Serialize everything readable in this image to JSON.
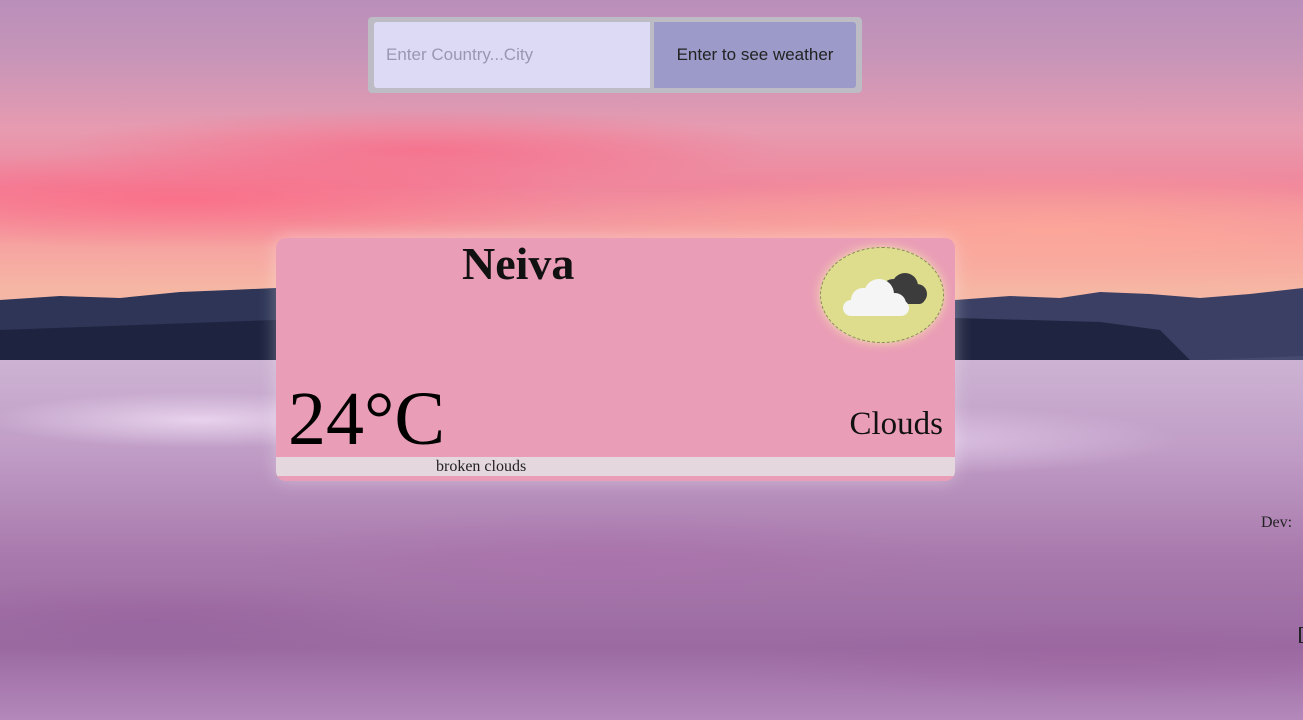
{
  "search": {
    "placeholder": "Enter Country...City",
    "value": "",
    "button_label": "Enter to see weather"
  },
  "weather": {
    "city": "Neiva",
    "temperature": "24°C",
    "condition": "Clouds",
    "description": "broken clouds",
    "icon": "broken-clouds-icon"
  },
  "footer": {
    "dev_label": "Dev:"
  },
  "colors": {
    "card": "#ea9db7",
    "icon_badge": "#dedd8e",
    "input_bg": "#dcdaf5",
    "button_bg": "#9b9ac8",
    "description_bar": "#e4d7dd"
  }
}
